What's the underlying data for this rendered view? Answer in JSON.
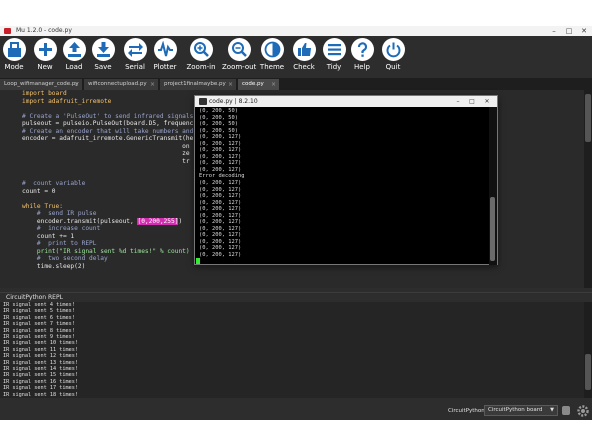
{
  "window": {
    "title": "Mu 1.2.0 - code.py"
  },
  "toolbar": [
    {
      "label": "Mode",
      "icon": "mode-icon"
    },
    {
      "label": "New",
      "icon": "plus-icon"
    },
    {
      "label": "Load",
      "icon": "upload-icon"
    },
    {
      "label": "Save",
      "icon": "download-icon"
    },
    {
      "label": "Serial",
      "icon": "serial-arrows-icon"
    },
    {
      "label": "Plotter",
      "icon": "plotter-wave-icon"
    },
    {
      "label": "Zoom-in",
      "icon": "zoom-in-icon"
    },
    {
      "label": "Zoom-out",
      "icon": "zoom-out-icon"
    },
    {
      "label": "Theme",
      "icon": "theme-icon"
    },
    {
      "label": "Check",
      "icon": "thumbs-up-icon"
    },
    {
      "label": "Tidy",
      "icon": "tidy-icon"
    },
    {
      "label": "Help",
      "icon": "help-icon"
    },
    {
      "label": "Quit",
      "icon": "power-icon"
    }
  ],
  "tabs": [
    {
      "label": "Loop_wifimanager_code.py",
      "active": false
    },
    {
      "label": "wificonnectupload.py",
      "active": false
    },
    {
      "label": "project1finalmaybe.py",
      "active": false
    },
    {
      "label": "code.py",
      "active": true
    }
  ],
  "editor": {
    "lines": [
      "import board",
      "import adafruit_irremote",
      "",
      "# Create a 'PulseOut' to send infrared signals",
      "pulseout = pulseio.PulseOut(board.D5, frequenc",
      "# Create an encoder that will take numbers and",
      "encoder = adafruit_irremote.GenericTransmit(he",
      "                                           on",
      "                                           ze",
      "                                           tr",
      "",
      "",
      "#  count variable",
      "count = 0",
      "",
      "while True:",
      "    #  send IR pulse",
      "    encoder.transmit(pulseout, [0,200,255])",
      "    #  increase count",
      "    count += 1",
      "    #  print to REPL",
      "    print(\"IR signal sent %d times!\" % count)",
      "    #  two second delay",
      "    time.sleep(2)"
    ]
  },
  "repl": {
    "title": "CircuitPython REPL",
    "lines": [
      "IR signal sent 4 times!",
      "IR signal sent 5 times!",
      "IR signal sent 6 times!",
      "IR signal sent 7 times!",
      "IR signal sent 8 times!",
      "IR signal sent 9 times!",
      "IR signal sent 10 times!",
      "IR signal sent 11 times!",
      "IR signal sent 12 times!",
      "IR signal sent 13 times!",
      "IR signal sent 14 times!",
      "IR signal sent 15 times!",
      "IR signal sent 16 times!",
      "IR signal sent 17 times!",
      "IR signal sent 18 times!"
    ]
  },
  "status": {
    "mode": "CircuitPython",
    "board": "CircuitPython board"
  },
  "serial_window": {
    "title": "code.py | 8.2.10",
    "lines": [
      "(0, 200, 50)",
      "(0, 200, 50)",
      "(0, 200, 50)",
      "(0, 200, 50)",
      "(0, 200, 127)",
      "(0, 200, 127)",
      "(0, 200, 127)",
      "(0, 200, 127)",
      "(0, 200, 127)",
      "(0, 200, 127)",
      "Error decoding",
      "(0, 200, 127)",
      "(0, 200, 127)",
      "(0, 200, 127)",
      "(0, 200, 127)",
      "(0, 200, 127)",
      "(0, 200, 127)",
      "(0, 200, 127)",
      "(0, 200, 127)",
      "(0, 200, 127)",
      "(0, 200, 127)",
      "(0, 200, 127)",
      "(0, 200, 127)"
    ]
  },
  "colors": {
    "accent": "#1e6bb8",
    "highlight": "#d22fb0",
    "cursor": "#33ee33"
  }
}
